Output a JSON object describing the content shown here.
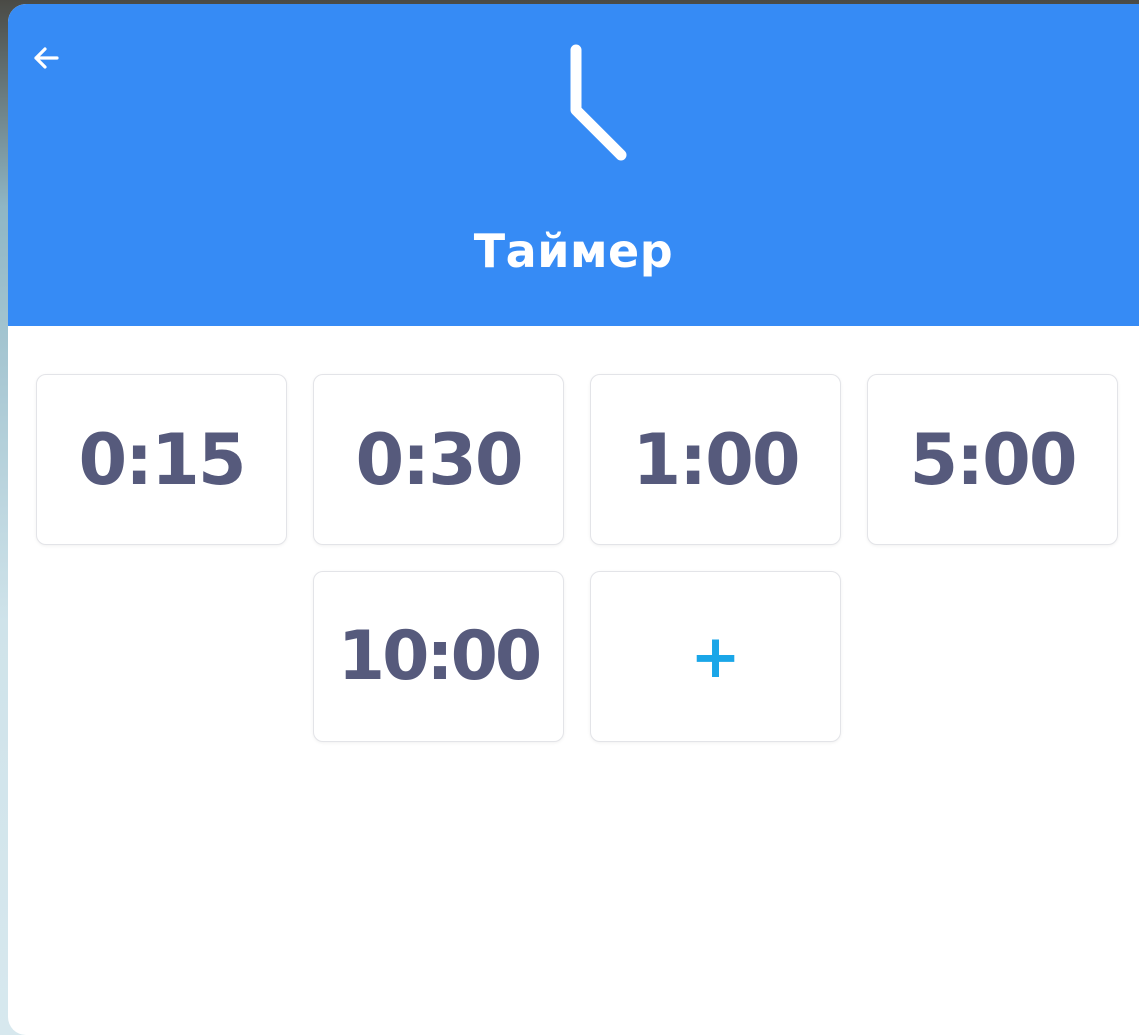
{
  "header": {
    "title": "Таймер",
    "background_color": "#368bf5",
    "back_icon": "arrow-left-icon",
    "clock_icon": "clock-icon"
  },
  "presets": [
    {
      "label": "0:15"
    },
    {
      "label": "0:30"
    },
    {
      "label": "1:00"
    },
    {
      "label": "5:00"
    },
    {
      "label": "10:00"
    }
  ],
  "add_button": {
    "label": "+",
    "color": "#1aa6e8"
  },
  "colors": {
    "tile_text": "#565a7c",
    "tile_border": "#e3e4e8"
  }
}
